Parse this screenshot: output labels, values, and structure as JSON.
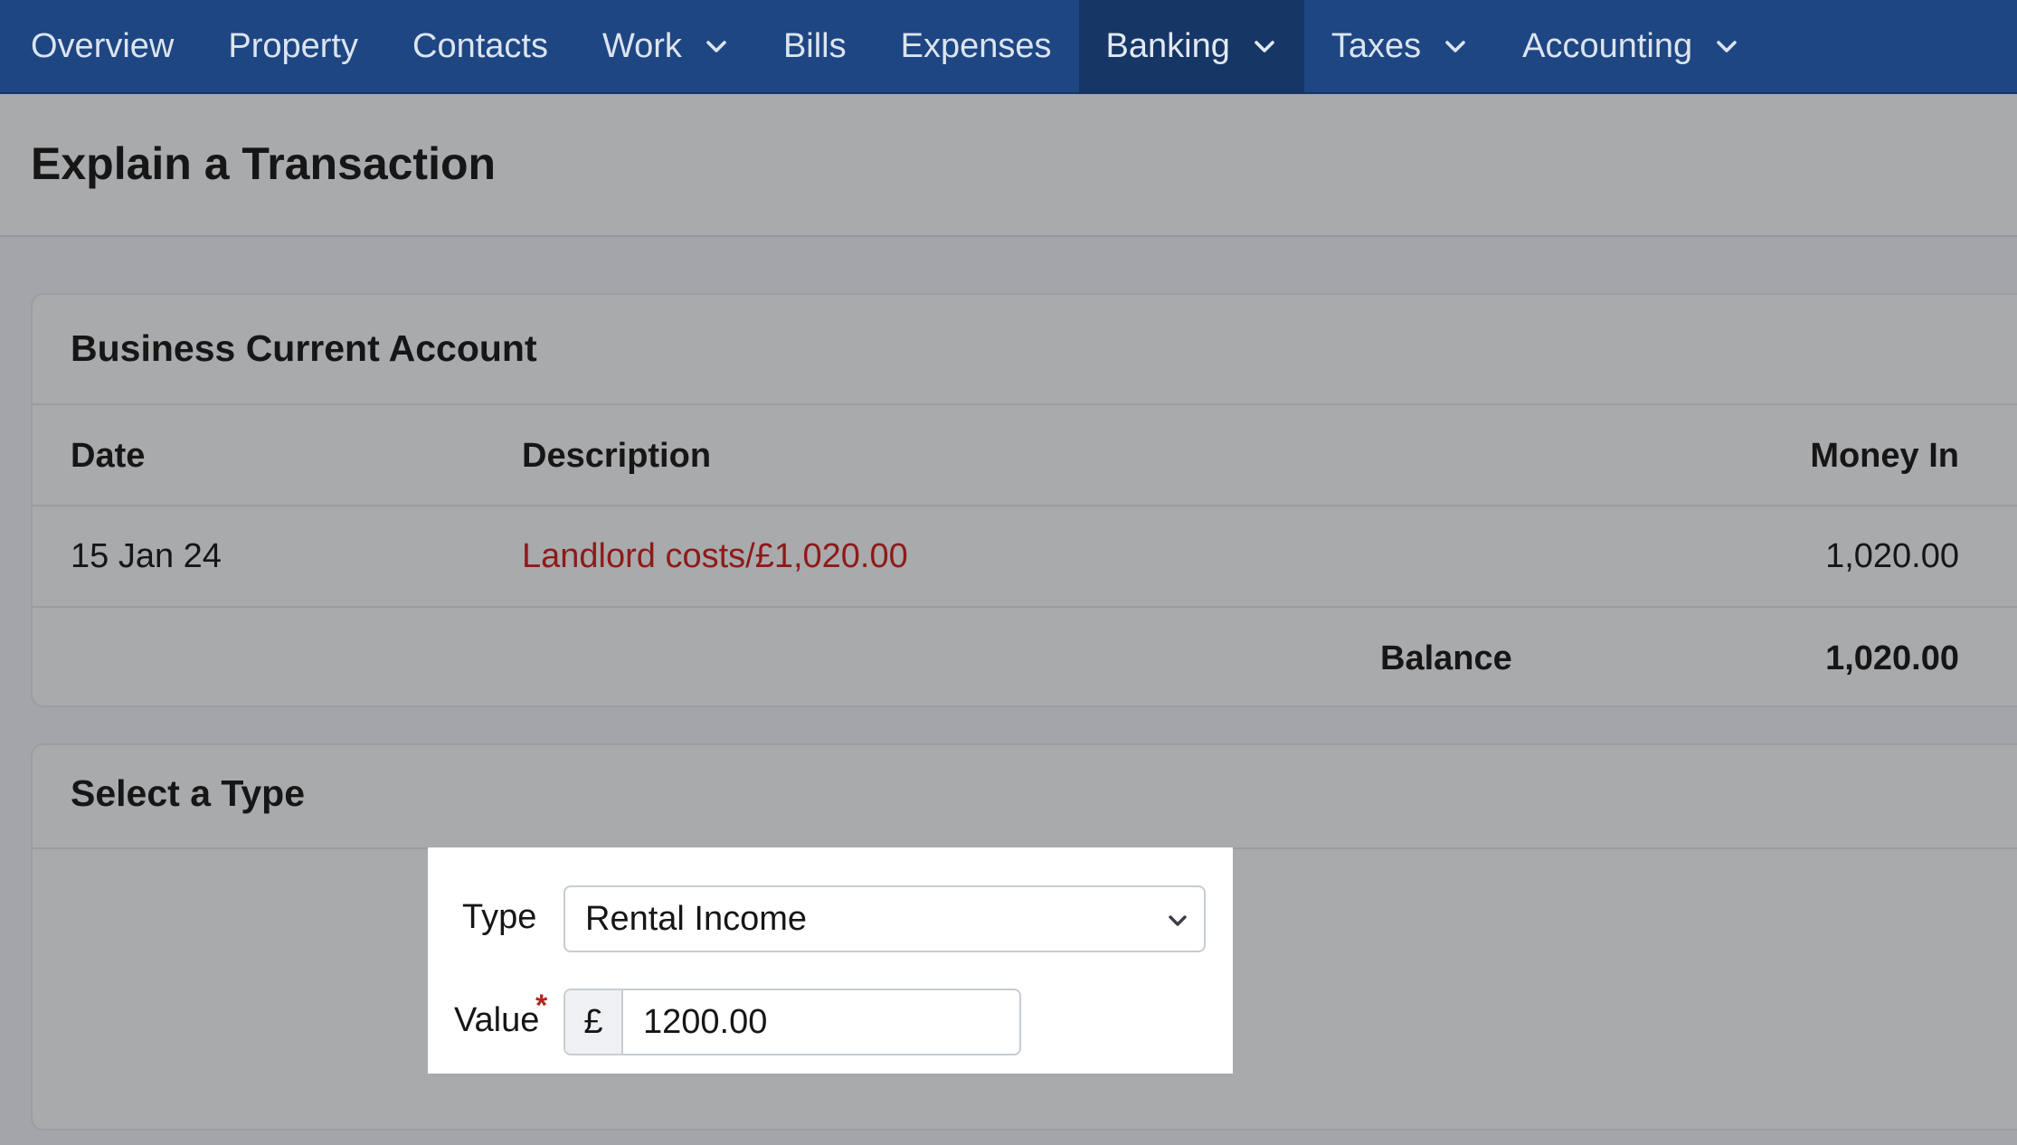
{
  "nav": {
    "items": [
      {
        "label": "Overview",
        "has_dropdown": false,
        "active": false
      },
      {
        "label": "Property",
        "has_dropdown": false,
        "active": false
      },
      {
        "label": "Contacts",
        "has_dropdown": false,
        "active": false
      },
      {
        "label": "Work",
        "has_dropdown": true,
        "active": false
      },
      {
        "label": "Bills",
        "has_dropdown": false,
        "active": false
      },
      {
        "label": "Expenses",
        "has_dropdown": false,
        "active": false
      },
      {
        "label": "Banking",
        "has_dropdown": true,
        "active": true
      },
      {
        "label": "Taxes",
        "has_dropdown": true,
        "active": false
      },
      {
        "label": "Accounting",
        "has_dropdown": true,
        "active": false
      }
    ],
    "dropdown_icon": "chevron-down-icon"
  },
  "page": {
    "title": "Explain a Transaction"
  },
  "account": {
    "title": "Business Current Account",
    "columns": {
      "date": "Date",
      "description": "Description",
      "money_in": "Money In"
    },
    "rows": [
      {
        "date": "15 Jan 24",
        "description": "Landlord costs/£1,020.00",
        "money_in": "1,020.00"
      }
    ],
    "balance_label": "Balance",
    "balance_value": "1,020.00"
  },
  "type_section": {
    "title": "Select a Type",
    "type_label": "Type",
    "type_value": "Rental Income",
    "value_label": "Value",
    "required_marker": "*",
    "currency_symbol": "£",
    "value": "1200.00"
  },
  "colors": {
    "nav_bg": "#1e4682",
    "nav_active_bg": "#163766",
    "link_red": "#8e1a1a",
    "required_red": "#b3261e"
  }
}
